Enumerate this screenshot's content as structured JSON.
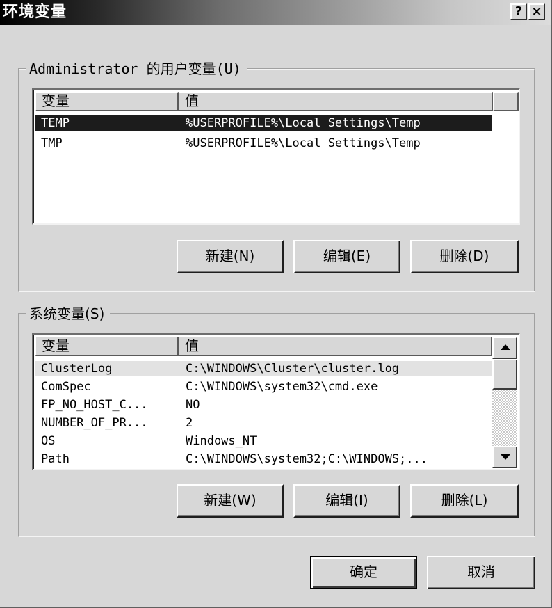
{
  "window": {
    "title": "环境变量",
    "help_glyph": "?",
    "close_glyph": "×"
  },
  "user_vars": {
    "legend": "Administrator 的用户变量(U)",
    "columns": [
      "变量",
      "值"
    ],
    "rows": [
      {
        "name": "TEMP",
        "value": "%USERPROFILE%\\Local Settings\\Temp",
        "selected": true
      },
      {
        "name": "TMP",
        "value": "%USERPROFILE%\\Local Settings\\Temp",
        "selected": false
      }
    ],
    "buttons": {
      "new": "新建(N)",
      "edit": "编辑(E)",
      "delete": "删除(D)"
    }
  },
  "system_vars": {
    "legend": "系统变量(S)",
    "columns": [
      "变量",
      "值"
    ],
    "rows": [
      {
        "name": "ClusterLog",
        "value": "C:\\WINDOWS\\Cluster\\cluster.log"
      },
      {
        "name": "ComSpec",
        "value": "C:\\WINDOWS\\system32\\cmd.exe"
      },
      {
        "name": "FP_NO_HOST_C...",
        "value": "NO"
      },
      {
        "name": "NUMBER_OF_PR...",
        "value": "2"
      },
      {
        "name": "OS",
        "value": "Windows_NT"
      },
      {
        "name": "Path",
        "value": "C:\\WINDOWS\\system32;C:\\WINDOWS;..."
      }
    ],
    "buttons": {
      "new": "新建(W)",
      "edit": "编辑(I)",
      "delete": "删除(L)"
    }
  },
  "footer": {
    "ok": "确定",
    "cancel": "取消"
  },
  "icons": {
    "scroll_up": "scroll-up-arrow",
    "scroll_down": "scroll-down-arrow"
  }
}
